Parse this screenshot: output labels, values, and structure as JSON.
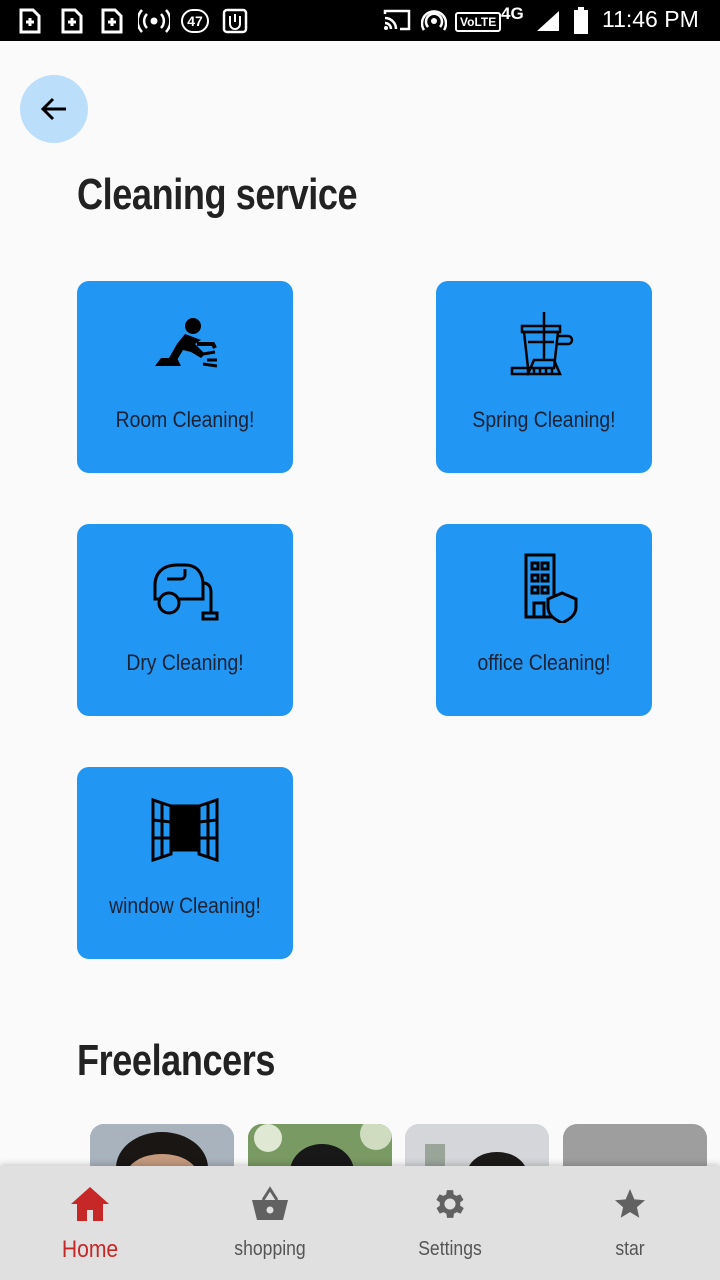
{
  "status_bar": {
    "notification_count": "47",
    "network_label": "VoLTE",
    "network_type": "4G",
    "time": "11:46 PM"
  },
  "page": {
    "title": "Cleaning service",
    "back_icon": "arrow-left-icon"
  },
  "services": [
    {
      "label": "Room Cleaning!",
      "icon": "person-cleaning-floor-icon"
    },
    {
      "label": "Spring Cleaning!",
      "icon": "bucket-mop-icon"
    },
    {
      "label": "Dry Cleaning!",
      "icon": "vacuum-cleaner-icon"
    },
    {
      "label": "office Cleaning!",
      "icon": "office-building-shield-icon"
    },
    {
      "label": "window Cleaning!",
      "icon": "open-window-icon"
    }
  ],
  "freelancers": {
    "title": "Freelancers",
    "items": [
      {
        "type": "photo"
      },
      {
        "type": "photo"
      },
      {
        "type": "photo"
      },
      {
        "type": "placeholder"
      }
    ]
  },
  "bottom_nav": {
    "items": [
      {
        "label": "Home",
        "icon": "home-icon",
        "active": true
      },
      {
        "label": "shopping",
        "icon": "basket-icon",
        "active": false
      },
      {
        "label": "Settings",
        "icon": "gear-icon",
        "active": false
      },
      {
        "label": "star",
        "icon": "star-icon",
        "active": false
      }
    ]
  },
  "colors": {
    "card": "#2196f3",
    "back_button": "#bbdefb",
    "active_nav": "#c62828",
    "background": "#fafafa"
  }
}
